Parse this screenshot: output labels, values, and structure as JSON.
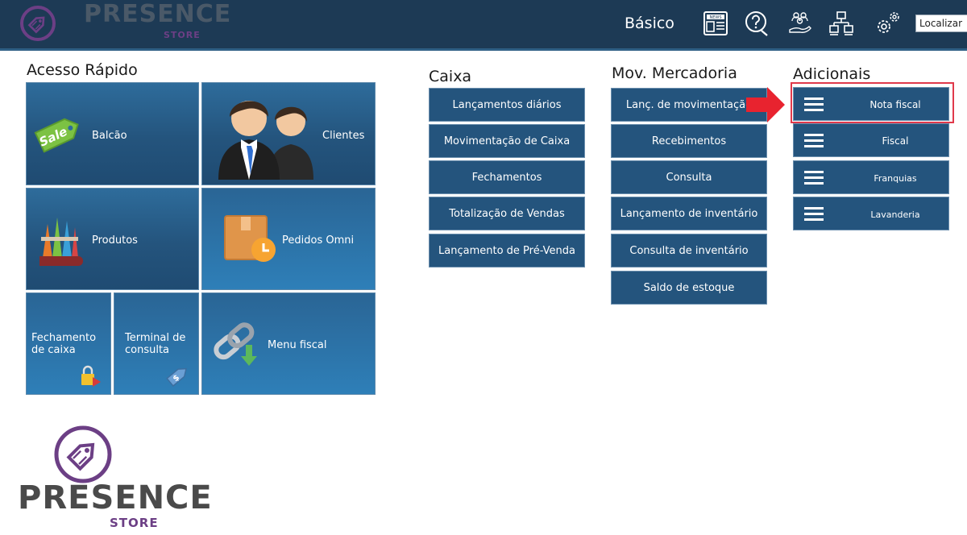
{
  "header": {
    "brand": "PRESENCE",
    "brand_sub": "STORE",
    "mode": "Básico",
    "search_value": "Localizar",
    "icons": [
      "news-icon",
      "help-icon",
      "users-icon",
      "network-icon",
      "settings-icon"
    ]
  },
  "quick_access": {
    "title": "Acesso Rápido",
    "tiles": [
      {
        "label": "Balcão",
        "icon": "sale-tag-icon"
      },
      {
        "label": "Clientes",
        "icon": "customers-icon"
      },
      {
        "label": "Produtos",
        "icon": "products-icon"
      },
      {
        "label": "Pedidos Omni",
        "icon": "omni-orders-icon"
      },
      {
        "label": "Fechamento de caixa",
        "icon": "lock-icon"
      },
      {
        "label": "Terminal de consulta",
        "icon": "price-tag-icon"
      },
      {
        "label": "Menu fiscal",
        "icon": "chain-link-icon"
      }
    ]
  },
  "caixa": {
    "title": "Caixa",
    "items": [
      "Lançamentos diários",
      "Movimentação de Caixa",
      "Fechamentos",
      "Totalização de Vendas",
      "Lançamento de Pré-Venda"
    ]
  },
  "mov": {
    "title": "Mov. Mercadoria",
    "items": [
      "Lanç. de movimentação",
      "Recebimentos",
      "Consulta",
      "Lançamento de inventário",
      "Consulta de inventário",
      "Saldo de estoque"
    ]
  },
  "adicionais": {
    "title": "Adicionais",
    "items": [
      "Nota fiscal",
      "Fiscal",
      "Franquias",
      "Lavanderia"
    ]
  },
  "colors": {
    "topbar": "#1d3a55",
    "tile": "#24547d",
    "brand_purple": "#6c3f85",
    "highlight": "#e0394b"
  },
  "footer": {
    "brand": "PRESENCE",
    "brand_sub": "STORE"
  }
}
